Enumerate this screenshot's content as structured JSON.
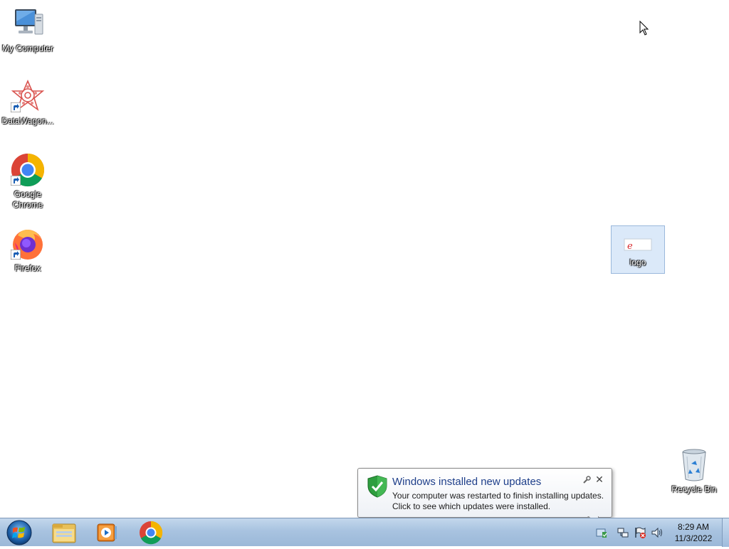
{
  "desktop": {
    "icons": [
      {
        "label": "My Computer",
        "icon": "computer-icon"
      },
      {
        "label": "DataWagon...",
        "icon": "datawagon-icon"
      },
      {
        "label": "Google Chrome",
        "icon": "chrome-icon"
      },
      {
        "label": "Firefox",
        "icon": "firefox-icon"
      },
      {
        "label": "logo",
        "icon": "image-file-icon"
      },
      {
        "label": "Recycle Bin",
        "icon": "recycle-bin-icon"
      }
    ]
  },
  "notification": {
    "title": "Windows installed new updates",
    "line1": "Your computer was restarted to finish installing updates.",
    "line2": "Click to see which updates were installed.",
    "close_glyph": "✕"
  },
  "taskbar": {
    "pinned": [
      {
        "name": "file-explorer",
        "icon": "folder-icon"
      },
      {
        "name": "media-player",
        "icon": "media-player-icon"
      },
      {
        "name": "chrome",
        "icon": "chrome-icon"
      }
    ],
    "clock": {
      "time": "8:29 AM",
      "date": "11/3/2022"
    }
  },
  "colors": {
    "taskbar": "#a8c3e0",
    "notification_title": "#1e3f8a",
    "desktop_background": "#ffffff"
  }
}
